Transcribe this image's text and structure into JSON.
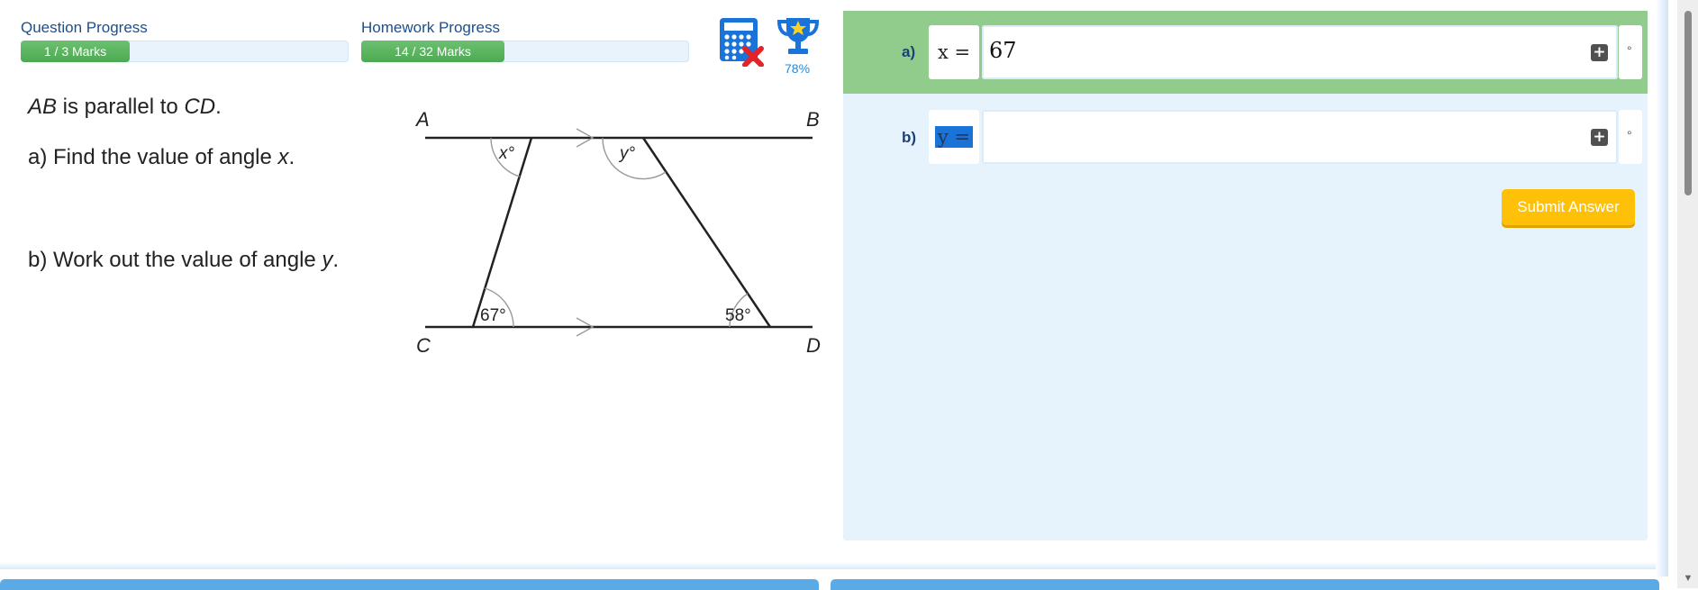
{
  "progress": {
    "question": {
      "label": "Question Progress",
      "text": "1 / 3 Marks",
      "fraction": 0.333
    },
    "homework": {
      "label": "Homework Progress",
      "text": "14 / 32 Marks",
      "fraction": 0.4375
    }
  },
  "tools": {
    "calculator_icon": "calculator-not-allowed-icon",
    "trophy_icon": "trophy-icon",
    "award_percent": "78%"
  },
  "question": {
    "line1_a": "AB",
    "line1_b": " is parallel to ",
    "line1_c": "CD",
    "line1_d": ".",
    "part_a_text": "a) Find the value of angle ",
    "part_a_var": "x",
    "part_a_end": ".",
    "part_b_text": "b) Work out the value of angle ",
    "part_b_var": "y",
    "part_b_end": "."
  },
  "diagram": {
    "points": {
      "A": "A",
      "B": "B",
      "C": "C",
      "D": "D"
    },
    "angles": {
      "x": "x°",
      "y": "y°",
      "c": "67°",
      "d": "58°"
    }
  },
  "answers": {
    "a": {
      "letter": "a)",
      "variable": "x =",
      "value": "67"
    },
    "b": {
      "letter": "b)",
      "variable": "y =",
      "value": ""
    }
  },
  "submit_label": "Submit Answer",
  "colors": {
    "progress_fill": "#4caa51",
    "correct_row": "#92cc8d",
    "panel": "#e6f3fc",
    "submit": "#ffc107",
    "brand_blue": "#1a73d9"
  }
}
